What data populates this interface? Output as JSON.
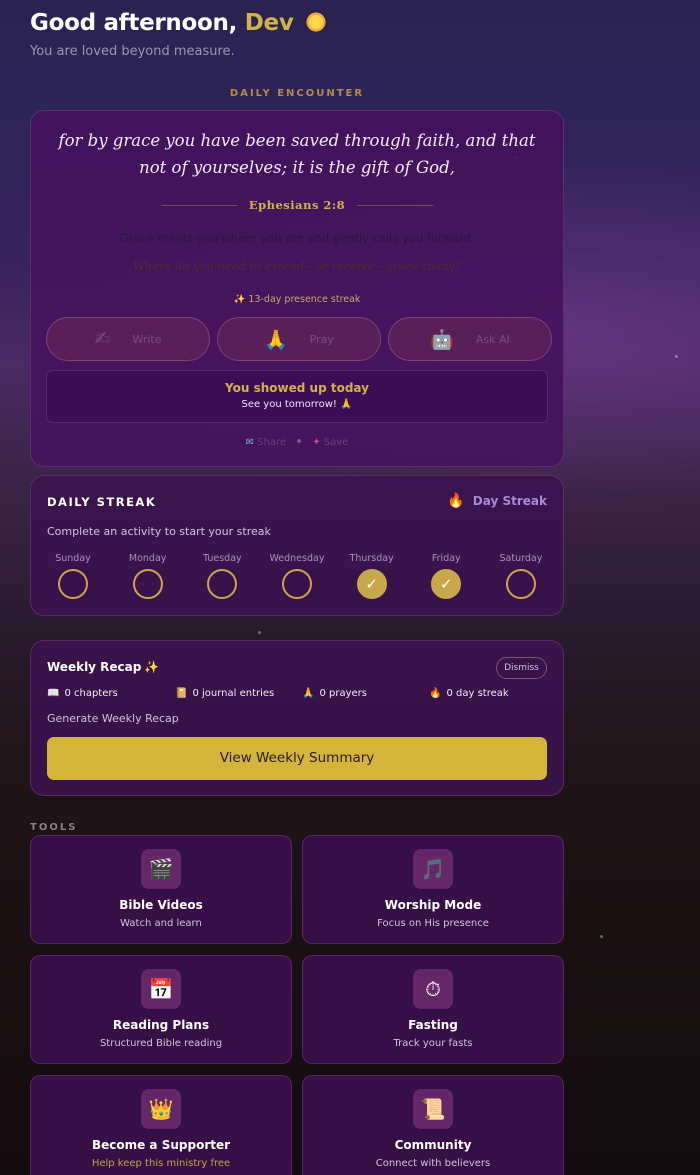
{
  "header": {
    "greeting_prefix": "Good afternoon,",
    "name": "Dev",
    "subtitle": "You are loved beyond measure."
  },
  "daily_encounter": {
    "label": "DAILY ENCOUNTER",
    "verse": "for by grace you have been saved through faith, and that not of yourselves; it is the gift of God,",
    "reference": "Ephesians 2:8",
    "reflection": "Grace meets you where you are and gently calls you forward.",
    "question": "Where do you need to extend—or receive—grace today?",
    "presence_streak": "✨ 13-day presence streak",
    "actions": [
      {
        "label": "Write",
        "icon": "✍"
      },
      {
        "label": "Pray",
        "icon": "🙏"
      },
      {
        "label": "Ask AI",
        "icon": "🤖"
      }
    ],
    "showed_up_title": "You showed up today",
    "showed_up_sub": "See you tomorrow! 🙏",
    "share_label": "Share",
    "save_label": "Save"
  },
  "streak": {
    "title": "DAILY STREAK",
    "badge": "Day Streak",
    "hint": "Complete an activity to start your streak",
    "days": [
      {
        "label": "Sunday",
        "done": false
      },
      {
        "label": "Monday",
        "done": false
      },
      {
        "label": "Tuesday",
        "done": false
      },
      {
        "label": "Wednesday",
        "done": false
      },
      {
        "label": "Thursday",
        "done": true
      },
      {
        "label": "Friday",
        "done": true
      },
      {
        "label": "Saturday",
        "done": false
      }
    ],
    "check": "✓"
  },
  "recap": {
    "title": "Weekly Recap",
    "dismiss": "Dismiss",
    "stats": [
      {
        "icon": "📖",
        "text": "0 chapters"
      },
      {
        "icon": "📔",
        "text": "0 journal entries"
      },
      {
        "icon": "🙏",
        "text": "0 prayers"
      },
      {
        "icon": "🔥",
        "text": "0 day streak"
      }
    ],
    "generate": "Generate Weekly Recap",
    "button": "View Weekly Summary"
  },
  "tools": {
    "label": "TOOLS",
    "items": [
      {
        "name": "Bible Videos",
        "sub": "Watch and learn",
        "icon": "🎬"
      },
      {
        "name": "Worship Mode",
        "sub": "Focus on His presence",
        "icon": "🎵"
      },
      {
        "name": "Reading Plans",
        "sub": "Structured Bible reading",
        "icon": "📅"
      },
      {
        "name": "Fasting",
        "sub": "Track your fasts",
        "icon": "⏱"
      },
      {
        "name": "Become a Supporter",
        "sub": "Help keep this ministry free",
        "icon": "👑"
      },
      {
        "name": "Community",
        "sub": "Connect with believers",
        "icon": "📜"
      }
    ]
  }
}
